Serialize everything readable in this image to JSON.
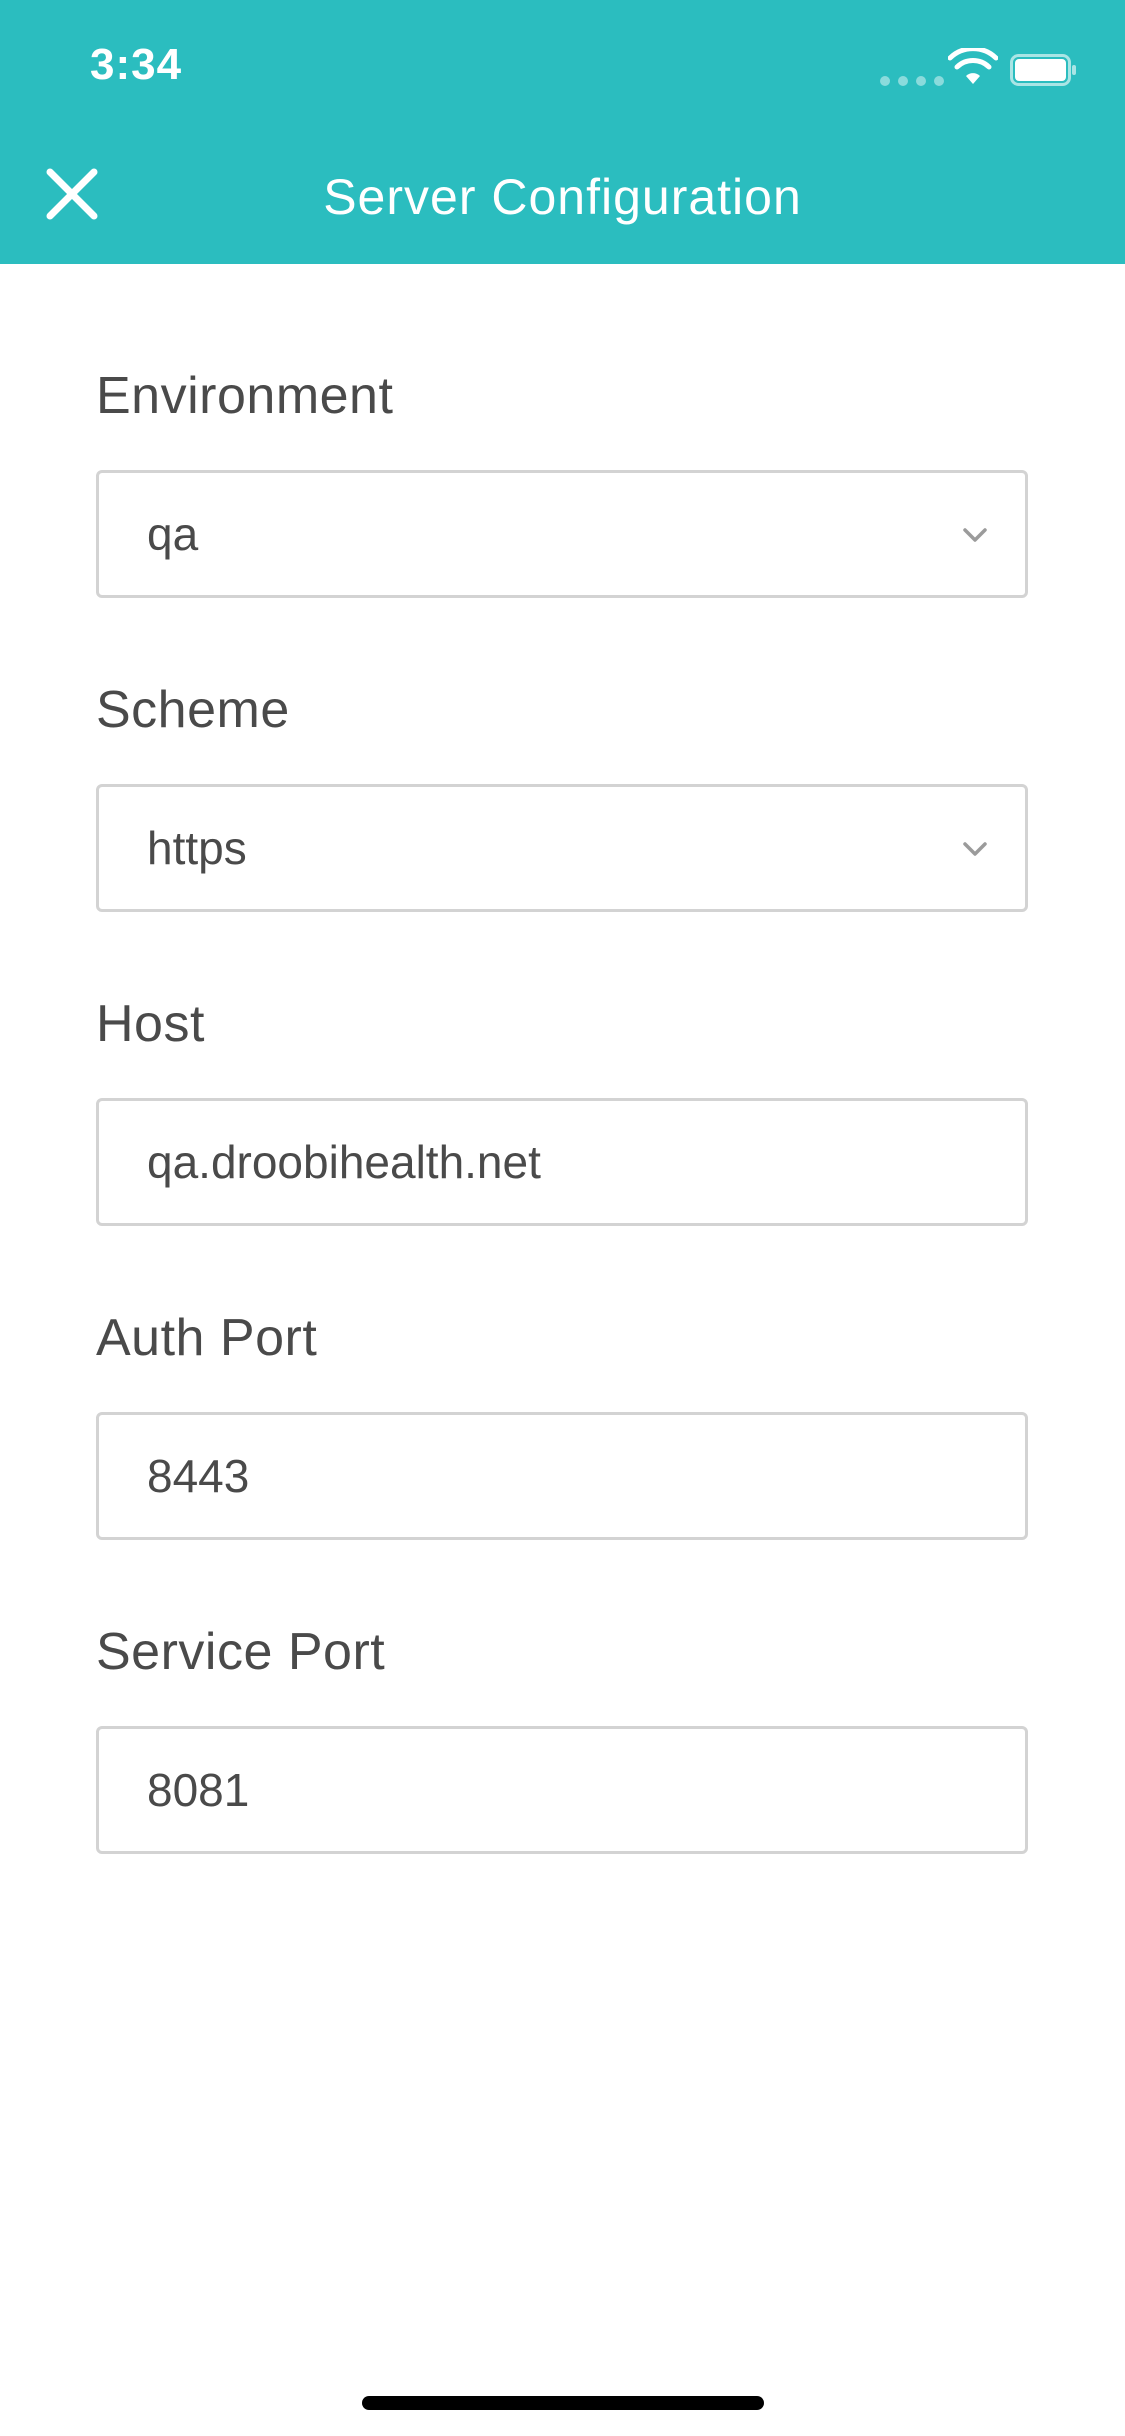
{
  "status_bar": {
    "time": "3:34",
    "icons": [
      "signal-dots-icon",
      "wifi-icon",
      "battery-icon"
    ]
  },
  "header": {
    "title": "Server Configuration",
    "close_icon": "close-icon",
    "background_color": "#2bbdbf"
  },
  "form": {
    "environment": {
      "label": "Environment",
      "value": "qa"
    },
    "scheme": {
      "label": "Scheme",
      "value": "https"
    },
    "host": {
      "label": "Host",
      "value": "qa.droobihealth.net"
    },
    "auth_port": {
      "label": "Auth Port",
      "value": "8443"
    },
    "service_port": {
      "label": "Service Port",
      "value": "8081"
    }
  }
}
